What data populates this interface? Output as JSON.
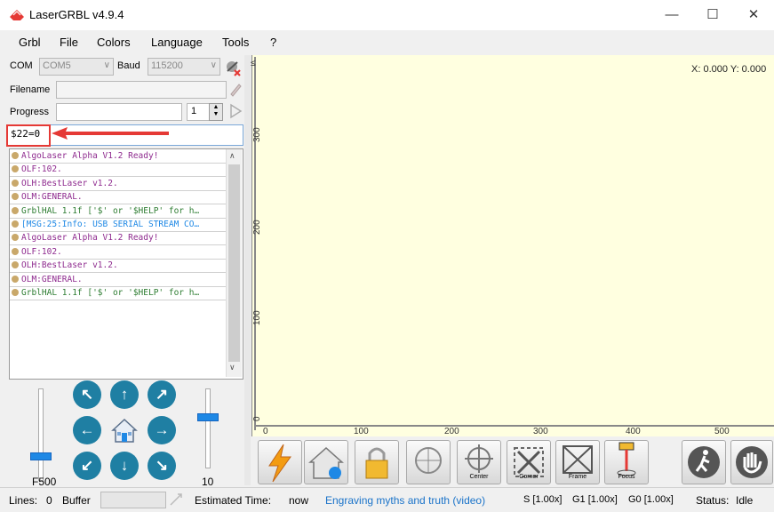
{
  "window": {
    "title": "LaserGRBL v4.9.4",
    "controls": [
      "—",
      "☐",
      "✕"
    ]
  },
  "menu": [
    "Grbl",
    "File",
    "Colors",
    "Language",
    "Tools",
    "?"
  ],
  "connection": {
    "com_label": "COM",
    "com_value": "COM5",
    "baud_label": "Baud",
    "baud_value": "115200"
  },
  "file": {
    "filename_label": "Filename",
    "filename_value": "",
    "progress_label": "Progress",
    "copies": "1"
  },
  "command": {
    "value": "$22=0"
  },
  "console_lines": [
    {
      "text": "AlgoLaser Alpha V1.2 Ready!",
      "color": "#8e2a8e"
    },
    {
      "text": "OLF:102.",
      "color": "#8e2a8e"
    },
    {
      "text": "OLH:BestLaser v1.2.",
      "color": "#8e2a8e"
    },
    {
      "text": "OLM:GENERAL.",
      "color": "#8e2a8e"
    },
    {
      "text": "GrblHAL 1.1f ['$' or '$HELP' for h…",
      "color": "#2e7d32"
    },
    {
      "text": "[MSG:25:Info: USB SERIAL STREAM CO…",
      "color": "#1e88e5"
    },
    {
      "text": "AlgoLaser Alpha V1.2 Ready!",
      "color": "#8e2a8e"
    },
    {
      "text": "OLF:102.",
      "color": "#8e2a8e"
    },
    {
      "text": "OLH:BestLaser v1.2.",
      "color": "#8e2a8e"
    },
    {
      "text": "OLM:GENERAL.",
      "color": "#8e2a8e"
    },
    {
      "text": "GrblHAL 1.1f ['$' or '$HELP' for h…",
      "color": "#2e7d32"
    }
  ],
  "jog": {
    "feed_label": "F500",
    "step_label": "10",
    "home_icon": "home-icon"
  },
  "canvas": {
    "coords": "X: 0.000 Y: 0.000",
    "y_ticks": [
      "300",
      "200",
      "100",
      "0"
    ],
    "x_ticks": [
      "0",
      "100",
      "200",
      "300",
      "400",
      "500"
    ],
    "background": "#ffffe0"
  },
  "toolbar": {
    "center_label": "Center",
    "corner_label": "Corner",
    "frame_label": "Frame",
    "focus_label": "Focus"
  },
  "status": {
    "lines_label": "Lines:",
    "lines_value": "0",
    "buffer_label": "Buffer",
    "estimated_label": "Estimated Time:",
    "estimated_value": "now",
    "link": "Engraving myths and truth (video)",
    "s_override": "S [1.00x]",
    "g1_override": "G1 [1.00x]",
    "g0_override": "G0 [1.00x]",
    "status_label": "Status:",
    "status_value": "Idle",
    "link_color": "#1a73c9"
  }
}
